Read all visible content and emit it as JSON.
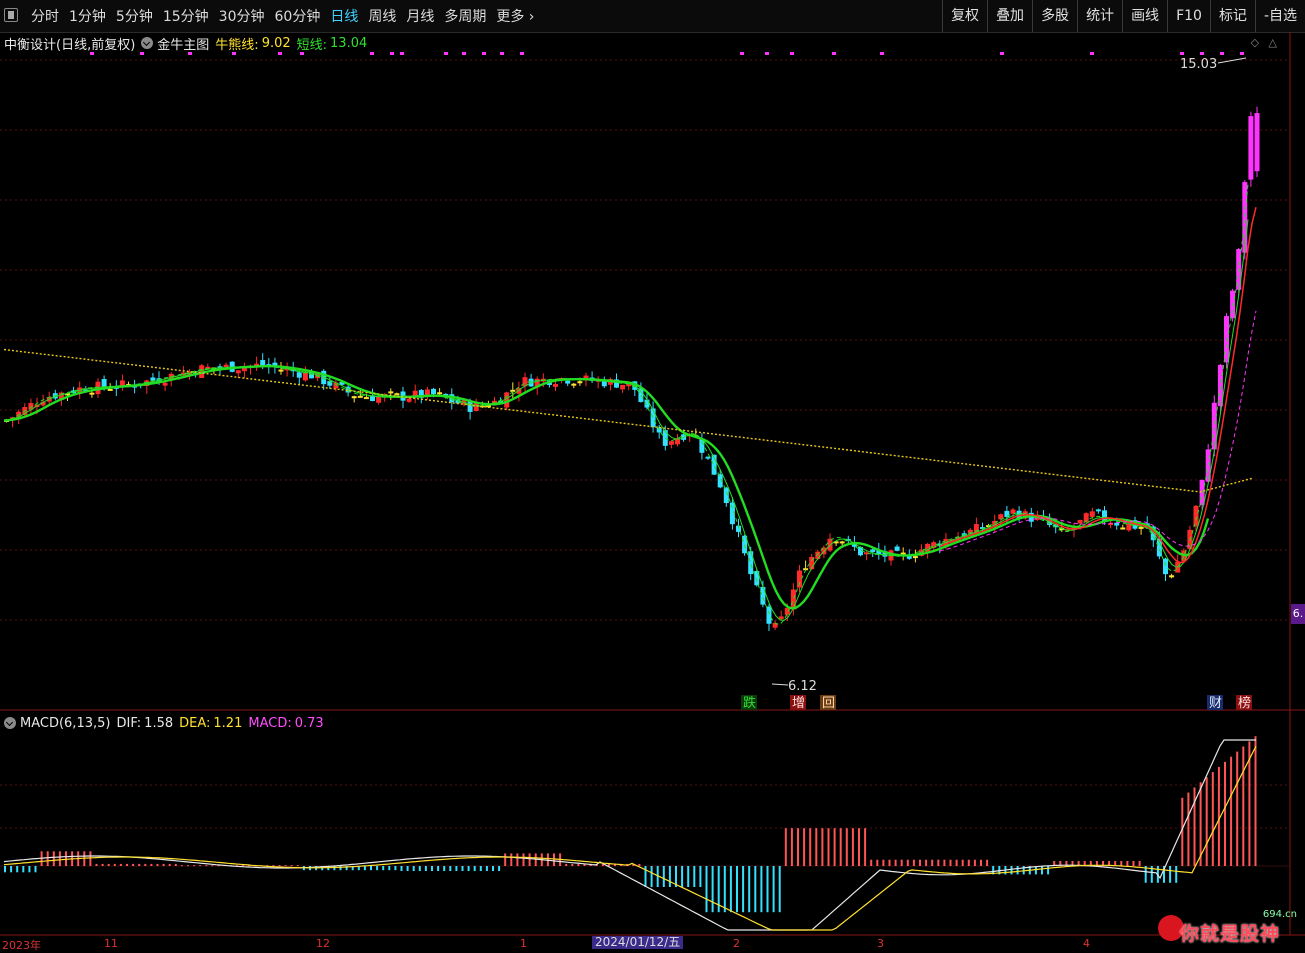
{
  "toolbar": {
    "period_tabs": [
      "分时",
      "1分钟",
      "5分钟",
      "15分钟",
      "30分钟",
      "60分钟",
      "日线",
      "周线",
      "月线",
      "多周期",
      "更多"
    ],
    "active_tab": "日线",
    "right_tools": [
      "复权",
      "叠加",
      "多股",
      "统计",
      "画线",
      "F10",
      "标记",
      "-自选"
    ]
  },
  "main_legend": {
    "stock": "中衡设计(日线,前复权)",
    "indicator": "金牛主图",
    "bull_line_label": "牛熊线:",
    "bull_line_value": "9.02",
    "short_line_label": "短线:",
    "short_line_value": "13.04"
  },
  "macd_legend": {
    "name": "MACD(6,13,5)",
    "dif_label": "DIF:",
    "dif_value": "1.58",
    "dea_label": "DEA:",
    "dea_value": "1.21",
    "macd_label": "MACD:",
    "macd_value": "0.73"
  },
  "annotations": {
    "high_value": "15.03",
    "low_value": "6.12",
    "signal_die": "跌",
    "signal_zeng": "增",
    "signal_hui": "回",
    "signal_cai": "财",
    "signal_bang": "榜"
  },
  "side_tag": "6.",
  "date_label": "2024/01/12/五",
  "axis_ticks": [
    "2023年",
    "11",
    "12",
    "1",
    "2",
    "3",
    "4"
  ],
  "watermark": {
    "site": "694.cn",
    "brand": "你就是股神"
  },
  "colors": {
    "up": "#ff2a2a",
    "down": "#33e0ff",
    "flat": "#ffe12e",
    "surge": "#ff33ff",
    "bull_line": "#e8c81a",
    "short_line": "#22dd22"
  }
}
